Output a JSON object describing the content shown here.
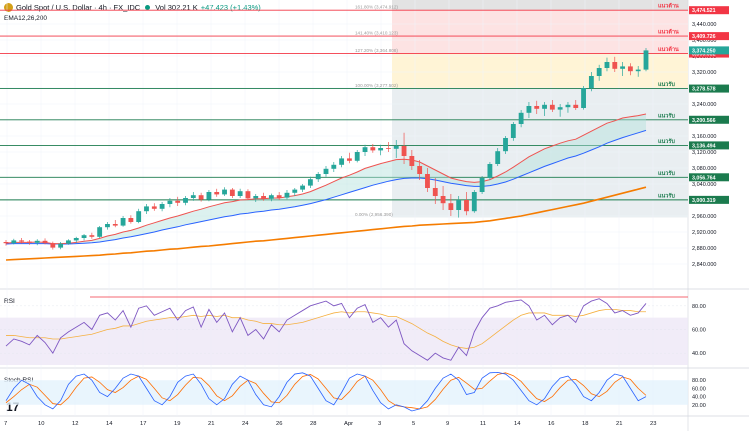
{
  "header": {
    "symbol": "Gold Spot / U.S. Dollar · 4h · FX_IDC",
    "volume": "Vol 302.21 K",
    "change": "+47.423 (+1.43%)",
    "ema_label": "EMA12,26,200"
  },
  "panes": {
    "rsi_label": "RSI",
    "stoch_label": "Stoch RSI"
  },
  "colors": {
    "up": "#26a69a",
    "down": "#ef5350",
    "ema12": "#ef5350",
    "ema26": "#2962ff",
    "ema200": "#f57c00",
    "resistance": "#f23645",
    "support": "#1b7b4e",
    "rsi": "#7e57c2",
    "stoch_k": "#2962ff",
    "stoch_d": "#ff6d00"
  },
  "chart_data": [
    {
      "type": "candlestick",
      "x_ticks": [
        "7",
        "10",
        "12",
        "14",
        "17",
        "19",
        "21",
        "24",
        "26",
        "28",
        "Apr",
        "3",
        "5",
        "9",
        "11",
        "14",
        "16",
        "18",
        "21",
        "23"
      ],
      "y_ticks": [
        2840,
        2880,
        2920,
        2960,
        3000,
        3040,
        3080,
        3120,
        3160,
        3200,
        3240,
        3280,
        3320,
        3360,
        3400,
        3440
      ],
      "ylim": [
        2830,
        3500
      ],
      "last_price_label": "3,374.250",
      "candles": [
        [
          2895,
          2900,
          2886,
          2892
        ],
        [
          2892,
          2903,
          2889,
          2899
        ],
        [
          2899,
          2905,
          2891,
          2896
        ],
        [
          2896,
          2900,
          2888,
          2893
        ],
        [
          2893,
          2902,
          2887,
          2898
        ],
        [
          2898,
          2904,
          2889,
          2892
        ],
        [
          2892,
          2896,
          2876,
          2881
        ],
        [
          2881,
          2895,
          2877,
          2891
        ],
        [
          2891,
          2902,
          2888,
          2899
        ],
        [
          2899,
          2908,
          2893,
          2905
        ],
        [
          2905,
          2915,
          2899,
          2912
        ],
        [
          2912,
          2918,
          2903,
          2908
        ],
        [
          2908,
          2935,
          2905,
          2932
        ],
        [
          2932,
          2945,
          2926,
          2940
        ],
        [
          2940,
          2950,
          2932,
          2936
        ],
        [
          2936,
          2960,
          2933,
          2955
        ],
        [
          2955,
          2962,
          2941,
          2945
        ],
        [
          2945,
          2978,
          2942,
          2972
        ],
        [
          2972,
          2990,
          2965,
          2984
        ],
        [
          2984,
          2992,
          2973,
          2978
        ],
        [
          2978,
          2995,
          2972,
          2990
        ],
        [
          2990,
          3005,
          2982,
          2998
        ],
        [
          2998,
          3008,
          2985,
          2993
        ],
        [
          2993,
          3010,
          2987,
          3005
        ],
        [
          3005,
          3020,
          2998,
          3012
        ],
        [
          3012,
          3018,
          2996,
          3001
        ],
        [
          3001,
          3025,
          2997,
          3020
        ],
        [
          3020,
          3028,
          3008,
          3014
        ],
        [
          3014,
          3032,
          3010,
          3026
        ],
        [
          3026,
          3030,
          3005,
          3010
        ],
        [
          3010,
          3028,
          3005,
          3022
        ],
        [
          3022,
          3027,
          3000,
          3004
        ],
        [
          3004,
          3015,
          2995,
          3010
        ],
        [
          3010,
          3018,
          2998,
          3003
        ],
        [
          3003,
          3016,
          2997,
          3012
        ],
        [
          3012,
          3020,
          3000,
          3006
        ],
        [
          3006,
          3025,
          3002,
          3018
        ],
        [
          3018,
          3030,
          3010,
          3026
        ],
        [
          3026,
          3040,
          3020,
          3036
        ],
        [
          3036,
          3058,
          3030,
          3052
        ],
        [
          3052,
          3070,
          3045,
          3065
        ],
        [
          3065,
          3085,
          3058,
          3078
        ],
        [
          3078,
          3095,
          3070,
          3088
        ],
        [
          3088,
          3110,
          3082,
          3104
        ],
        [
          3104,
          3118,
          3092,
          3098
        ],
        [
          3098,
          3125,
          3094,
          3120
        ],
        [
          3120,
          3138,
          3110,
          3132
        ],
        [
          3132,
          3140,
          3118,
          3124
        ],
        [
          3124,
          3138,
          3112,
          3130
        ],
        [
          3130,
          3145,
          3120,
          3128
        ],
        [
          3128,
          3150,
          3105,
          3135
        ],
        [
          3135,
          3168,
          3090,
          3110
        ],
        [
          3110,
          3125,
          3075,
          3085
        ],
        [
          3085,
          3100,
          3050,
          3065
        ],
        [
          3065,
          3080,
          3020,
          3030
        ],
        [
          3030,
          3055,
          2990,
          3010
        ],
        [
          3010,
          3035,
          2975,
          2992
        ],
        [
          2992,
          3015,
          2960,
          2975
        ],
        [
          2975,
          3010,
          2956,
          3000
        ],
        [
          3000,
          3020,
          2962,
          2972
        ],
        [
          2972,
          3025,
          2968,
          3020
        ],
        [
          3020,
          3060,
          3015,
          3055
        ],
        [
          3055,
          3095,
          3050,
          3090
        ],
        [
          3090,
          3130,
          3085,
          3122
        ],
        [
          3122,
          3160,
          3115,
          3155
        ],
        [
          3155,
          3195,
          3148,
          3190
        ],
        [
          3190,
          3225,
          3182,
          3218
        ],
        [
          3218,
          3245,
          3205,
          3235
        ],
        [
          3235,
          3248,
          3215,
          3228
        ],
        [
          3228,
          3245,
          3210,
          3238
        ],
        [
          3238,
          3250,
          3220,
          3226
        ],
        [
          3226,
          3240,
          3208,
          3232
        ],
        [
          3232,
          3245,
          3218,
          3238
        ],
        [
          3238,
          3250,
          3225,
          3230
        ],
        [
          3230,
          3285,
          3226,
          3280
        ],
        [
          3280,
          3320,
          3272,
          3310
        ],
        [
          3310,
          3338,
          3298,
          3330
        ],
        [
          3330,
          3356,
          3322,
          3345
        ],
        [
          3345,
          3358,
          3320,
          3328
        ],
        [
          3328,
          3345,
          3310,
          3334
        ],
        [
          3334,
          3342,
          3312,
          3322
        ],
        [
          3322,
          3335,
          3308,
          3326
        ],
        [
          3326,
          3380,
          3322,
          3374
        ]
      ],
      "ema12": [
        2892,
        2894,
        2894,
        2894,
        2895,
        2894,
        2891,
        2891,
        2892,
        2894,
        2897,
        2899,
        2904,
        2910,
        2914,
        2920,
        2924,
        2930,
        2937,
        2943,
        2949,
        2955,
        2960,
        2966,
        2972,
        2977,
        2983,
        2988,
        2993,
        2996,
        3000,
        3001,
        3003,
        3003,
        3005,
        3005,
        3008,
        3011,
        3015,
        3021,
        3029,
        3037,
        3046,
        3055,
        3062,
        3070,
        3079,
        3085,
        3091,
        3096,
        3101,
        3102,
        3100,
        3095,
        3085,
        3075,
        3065,
        3055,
        3050,
        3046,
        3044,
        3046,
        3051,
        3060,
        3070,
        3082,
        3095,
        3108,
        3118,
        3128,
        3135,
        3142,
        3148,
        3152,
        3162,
        3172,
        3182,
        3192,
        3198,
        3205,
        3208,
        3211,
        3215
      ],
      "ema26": [
        2890,
        2891,
        2891,
        2891,
        2891,
        2891,
        2890,
        2890,
        2890,
        2891,
        2892,
        2893,
        2895,
        2898,
        2901,
        2905,
        2908,
        2912,
        2916,
        2920,
        2925,
        2929,
        2933,
        2938,
        2942,
        2946,
        2950,
        2954,
        2958,
        2961,
        2965,
        2967,
        2970,
        2972,
        2975,
        2977,
        2980,
        2983,
        2987,
        2991,
        2996,
        3001,
        3007,
        3013,
        3019,
        3025,
        3031,
        3037,
        3042,
        3047,
        3051,
        3054,
        3055,
        3055,
        3053,
        3050,
        3046,
        3042,
        3039,
        3036,
        3034,
        3034,
        3036,
        3040,
        3045,
        3052,
        3060,
        3068,
        3076,
        3084,
        3091,
        3098,
        3105,
        3110,
        3117,
        3125,
        3133,
        3142,
        3149,
        3156,
        3162,
        3168,
        3174
      ],
      "ema200": [
        2850,
        2851,
        2852,
        2853,
        2854,
        2855,
        2856,
        2857,
        2858,
        2859,
        2860,
        2861,
        2862,
        2864,
        2865,
        2867,
        2868,
        2870,
        2872,
        2873,
        2875,
        2877,
        2878,
        2880,
        2882,
        2884,
        2885,
        2887,
        2889,
        2891,
        2893,
        2895,
        2897,
        2898,
        2900,
        2902,
        2904,
        2906,
        2908,
        2910,
        2912,
        2914,
        2916,
        2918,
        2920,
        2922,
        2924,
        2926,
        2928,
        2930,
        2932,
        2934,
        2935,
        2937,
        2938,
        2939,
        2940,
        2941,
        2942,
        2943,
        2944,
        2946,
        2948,
        2951,
        2954,
        2957,
        2960,
        2964,
        2968,
        2972,
        2976,
        2980,
        2984,
        2988,
        2992,
        2997,
        3002,
        3007,
        3012,
        3017,
        3022,
        3027,
        3032
      ],
      "levels": [
        {
          "price": 3474.521,
          "label": "3,474.521",
          "kind": "resistance",
          "tag": "แนวต้าน"
        },
        {
          "price": 3409.726,
          "label": "3,409.726",
          "kind": "resistance",
          "tag": "แนวต้าน"
        },
        {
          "price": 3366.082,
          "label": "3,366.082",
          "kind": "resistance",
          "tag": "แนวต้าน"
        },
        {
          "price": 3278.578,
          "label": "3,278.578",
          "kind": "support",
          "tag": "แนวรับ"
        },
        {
          "price": 3200.566,
          "label": "3,200.566",
          "kind": "support",
          "tag": "แนวรับ"
        },
        {
          "price": 3136.494,
          "label": "3,136.494",
          "kind": "support",
          "tag": "แนวรับ"
        },
        {
          "price": 3056.764,
          "label": "3,056.764",
          "kind": "support",
          "tag": "แนวรับ"
        },
        {
          "price": 3000.319,
          "label": "3,000.319",
          "kind": "support",
          "tag": "แนวรับ"
        }
      ],
      "fib": [
        {
          "price": 3474.521,
          "label": "161.80% (3,474.912)"
        },
        {
          "price": 3409.726,
          "label": "141.40% (3,410.123)"
        },
        {
          "price": 3366.082,
          "label": "127.20% (3,364.808)"
        },
        {
          "price": 3278.578,
          "label": "100.00% (3,277.502)"
        },
        {
          "price": 2956.378,
          "label": "0.00% (2,956.390)"
        }
      ]
    },
    {
      "type": "line",
      "name": "RSI",
      "y_ticks": [
        40,
        60,
        80
      ],
      "ylim": [
        30,
        90
      ],
      "overbought": 70,
      "oversold": 30,
      "rsi": [
        46,
        52,
        50,
        47,
        55,
        49,
        40,
        53,
        58,
        62,
        66,
        60,
        72,
        74,
        68,
        76,
        62,
        78,
        80,
        72,
        75,
        78,
        68,
        76,
        79,
        62,
        77,
        66,
        74,
        58,
        70,
        55,
        60,
        52,
        64,
        58,
        68,
        72,
        76,
        80,
        82,
        84,
        80,
        82,
        70,
        78,
        81,
        66,
        70,
        62,
        68,
        48,
        42,
        38,
        34,
        40,
        36,
        34,
        45,
        38,
        58,
        70,
        78,
        80,
        83,
        84,
        85,
        80,
        68,
        72,
        64,
        70,
        72,
        66,
        80,
        84,
        86,
        82,
        74,
        76,
        72,
        74,
        82
      ],
      "signal": [
        55,
        55,
        54,
        53,
        53,
        53,
        52,
        52,
        53,
        54,
        55,
        56,
        58,
        60,
        61,
        63,
        63,
        65,
        67,
        68,
        69,
        70,
        70,
        71,
        72,
        71,
        72,
        71,
        72,
        70,
        70,
        68,
        67,
        65,
        65,
        64,
        64,
        65,
        66,
        68,
        70,
        72,
        74,
        75,
        74,
        75,
        75,
        74,
        73,
        71,
        71,
        68,
        65,
        61,
        57,
        54,
        50,
        47,
        45,
        44,
        45,
        48,
        53,
        58,
        63,
        68,
        72,
        74,
        74,
        74,
        72,
        72,
        72,
        71,
        72,
        74,
        76,
        77,
        77,
        76,
        76,
        75,
        75
      ]
    },
    {
      "type": "line",
      "name": "Stoch RSI",
      "y_ticks": [
        20,
        40,
        60,
        80
      ],
      "ylim": [
        0,
        100
      ],
      "k": [
        30,
        60,
        80,
        70,
        40,
        20,
        10,
        30,
        70,
        90,
        95,
        80,
        50,
        40,
        60,
        85,
        95,
        90,
        60,
        30,
        20,
        40,
        75,
        90,
        95,
        70,
        35,
        20,
        35,
        70,
        90,
        80,
        45,
        20,
        15,
        40,
        75,
        95,
        98,
        90,
        60,
        30,
        20,
        50,
        85,
        95,
        90,
        55,
        25,
        10,
        20,
        15,
        5,
        10,
        30,
        60,
        85,
        95,
        80,
        45,
        50,
        85,
        98,
        99,
        95,
        80,
        55,
        30,
        20,
        35,
        65,
        85,
        90,
        70,
        40,
        30,
        50,
        80,
        95,
        90,
        60,
        30,
        40
      ],
      "d": [
        25,
        40,
        57,
        70,
        63,
        43,
        23,
        20,
        37,
        63,
        85,
        88,
        75,
        57,
        50,
        62,
        80,
        90,
        82,
        60,
        37,
        30,
        45,
        68,
        87,
        85,
        67,
        42,
        30,
        42,
        65,
        80,
        72,
        48,
        27,
        25,
        43,
        70,
        89,
        94,
        83,
        60,
        37,
        33,
        52,
        77,
        90,
        80,
        57,
        30,
        18,
        15,
        13,
        10,
        15,
        33,
        58,
        80,
        87,
        73,
        58,
        60,
        78,
        94,
        98,
        91,
        77,
        55,
        35,
        28,
        40,
        62,
        80,
        82,
        67,
        47,
        40,
        53,
        75,
        88,
        82,
        60,
        43
      ]
    }
  ]
}
